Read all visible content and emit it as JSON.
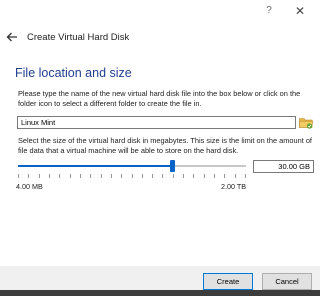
{
  "window": {
    "help_label": "?",
    "close_label": "✕"
  },
  "header": {
    "title": "Create Virtual Hard Disk"
  },
  "section": {
    "title": "File location and size"
  },
  "location": {
    "instructions": "Please type the name of the new virtual hard disk file into the box below or click on the folder icon to select a different folder to create the file in.",
    "file_name": "Linux Mint"
  },
  "size": {
    "instructions": "Select the size of the virtual hard disk in megabytes. This size is the limit on the amount of file data that a virtual machine will be able to store on the hard disk.",
    "value": "30.00 GB",
    "slider_fraction": 0.675,
    "min_label": "4.00 MB",
    "max_label": "2.00 TB"
  },
  "footer": {
    "create_label": "Create",
    "cancel_label": "Cancel"
  },
  "colors": {
    "title": "#1f3f8f",
    "accent": "#0a64c8",
    "folder": "#e8b84a"
  }
}
